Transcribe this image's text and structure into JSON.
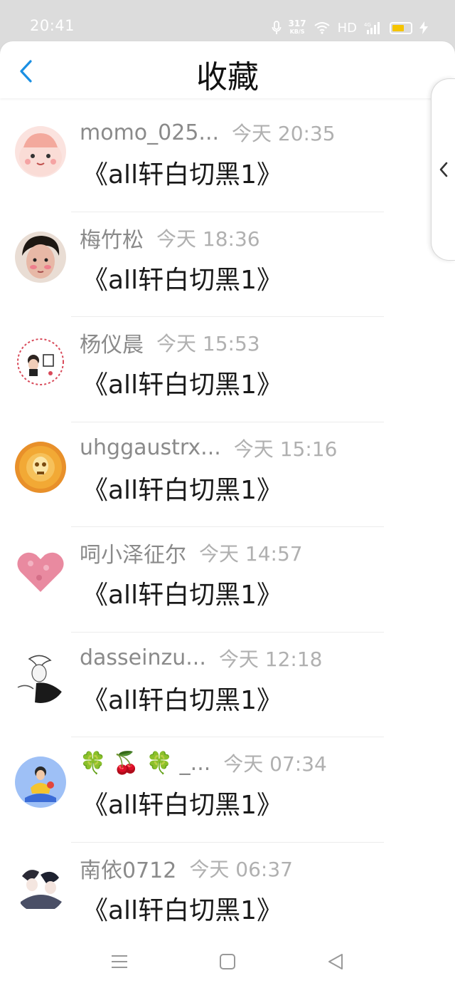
{
  "status": {
    "time": "20:41",
    "speed_value": "317",
    "speed_unit": "KB/S",
    "hd": "HD",
    "network": "4G"
  },
  "header": {
    "title": "收藏",
    "back_icon": "chevron-left-icon"
  },
  "side_tab": {
    "icon": "chevron-left-icon"
  },
  "items": [
    {
      "name": "momo_025...",
      "time": "今天 20:35",
      "content": "《all轩白切黑1》",
      "avatar_color": "#f6c9c4"
    },
    {
      "name": "梅竹松",
      "time": "今天 18:36",
      "content": "《all轩白切黑1》",
      "avatar_color": "#d9b8a6"
    },
    {
      "name": "杨仪晨",
      "time": "今天 15:53",
      "content": "《all轩白切黑1》",
      "avatar_color": "#fbe9ea"
    },
    {
      "name": "uhggaustrx...",
      "time": "今天 15:16",
      "content": "《all轩白切黑1》",
      "avatar_color": "#f0a020"
    },
    {
      "name": "呞小泽征尔",
      "time": "今天 14:57",
      "content": "《all轩白切黑1》",
      "avatar_color": "#e98aa0"
    },
    {
      "name": "dasseinzu...",
      "time": "今天 12:18",
      "content": "《all轩白切黑1》",
      "avatar_color": "#eeeeee"
    },
    {
      "name": "🍀 🍒 🍀 _...",
      "time": "今天 07:34",
      "content": "《all轩白切黑1》",
      "avatar_color": "#8fb4f2"
    },
    {
      "name": "南依0712",
      "time": "今天 06:37",
      "content": "《all轩白切黑1》",
      "avatar_color": "#d7d7df"
    }
  ],
  "nav": {
    "menu_icon": "menu-icon",
    "home_icon": "square-home-icon",
    "back_icon": "triangle-back-icon"
  }
}
